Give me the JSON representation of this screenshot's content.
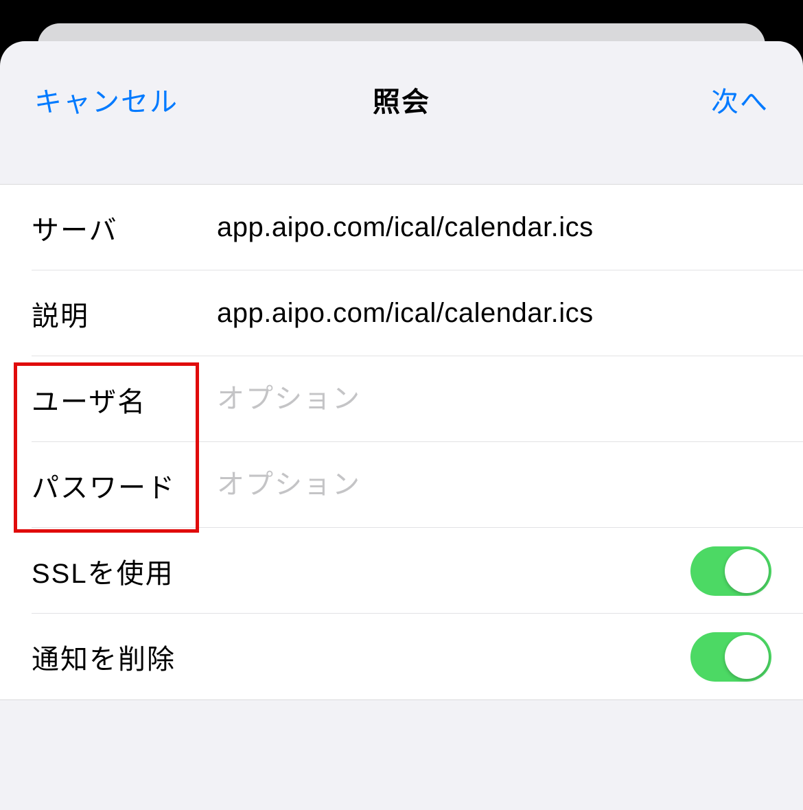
{
  "nav": {
    "cancel": "キャンセル",
    "title": "照会",
    "next": "次へ"
  },
  "fields": {
    "server": {
      "label": "サーバ",
      "value": "app.aipo.com/ical/calendar.ics"
    },
    "description": {
      "label": "説明",
      "value": "app.aipo.com/ical/calendar.ics"
    },
    "username": {
      "label": "ユーザ名",
      "placeholder": "オプション",
      "value": ""
    },
    "password": {
      "label": "パスワード",
      "placeholder": "オプション",
      "value": ""
    },
    "ssl": {
      "label": "SSLを使用",
      "enabled": true
    },
    "removeNotifications": {
      "label": "通知を削除",
      "enabled": true
    }
  }
}
